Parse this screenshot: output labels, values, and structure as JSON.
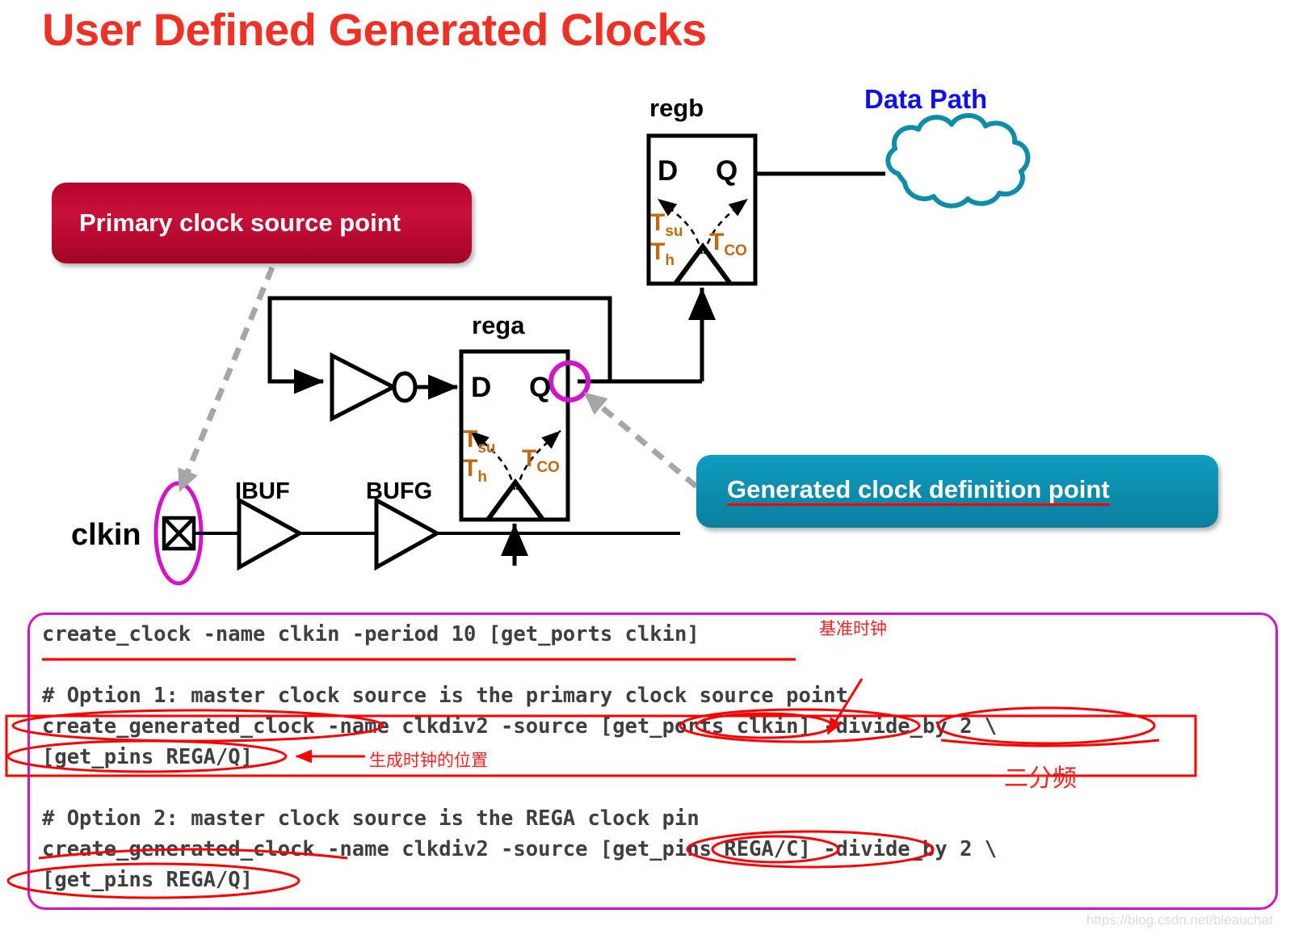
{
  "page": {
    "title": "User Defined Generated Clocks",
    "title_color": "#ee3124",
    "watermark": "https://blog.csdn.net/bleauchat"
  },
  "callouts": [
    {
      "id": "primary",
      "label": "Primary clock source point",
      "color": "#b4062c",
      "text_color": "#ffffff"
    },
    {
      "id": "generated",
      "label": "Generated clock definition point",
      "color": "#0e8eb0",
      "text_color": "#ffffff",
      "underline_color": "#ff0000"
    }
  ],
  "diagram": {
    "data_path_label": "Data Path",
    "data_path_color": "#1010ee",
    "cloud_color": "#0f8ca8",
    "highlight_color": "#d315c8",
    "pointer_color": "#a6a6a6",
    "registers": [
      {
        "name": "regb",
        "d_label": "D",
        "q_label": "Q",
        "t_su": "T",
        "t_su_sub": "su",
        "t_h": "T",
        "t_h_sub": "h",
        "t_co": "T",
        "t_co_sub": "CO"
      },
      {
        "name": "rega",
        "d_label": "D",
        "q_label": "Q",
        "t_su": "T",
        "t_su_sub": "su",
        "t_h": "T",
        "t_h_sub": "h",
        "t_co": "T",
        "t_co_sub": "CO"
      }
    ],
    "port_label": "clkin",
    "buffers": [
      {
        "name": "IBUF"
      },
      {
        "name": "BUFG"
      }
    ]
  },
  "code": {
    "border_color": "#d315c8",
    "text_color": "#3f3f3f",
    "lines": [
      "create_clock -name clkin -period 10 [get_ports clkin]",
      "",
      "# Option 1: master clock source is the primary clock source point",
      "create_generated_clock -name clkdiv2 -source [get_ports clkin] -divide_by 2 \\",
      "[get_pins REGA/Q]",
      "",
      "# Option 2: master clock source is the REGA clock pin",
      "create_generated_clock -name clkdiv2 -source [get_pins REGA/C] -divide_by 2 \\",
      "[get_pins REGA/Q]"
    ]
  },
  "annotations": {
    "color": "#ff2020",
    "notes": [
      {
        "id": "base-clock",
        "text": "基准时钟"
      },
      {
        "id": "generated-clock-location",
        "text": "生成时钟的位置"
      },
      {
        "id": "divide-by-two",
        "text": "二分频"
      }
    ]
  }
}
